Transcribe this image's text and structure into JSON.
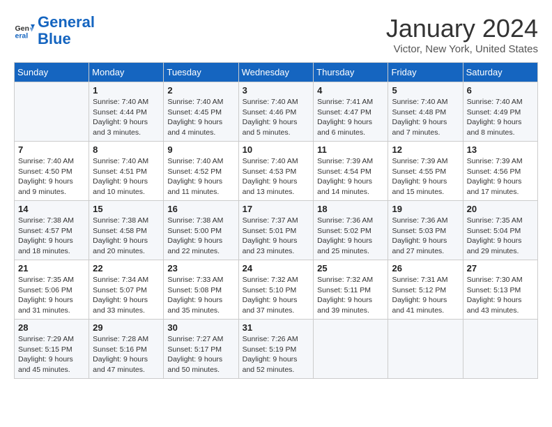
{
  "logo": {
    "text_general": "General",
    "text_blue": "Blue"
  },
  "title": "January 2024",
  "location": "Victor, New York, United States",
  "headers": [
    "Sunday",
    "Monday",
    "Tuesday",
    "Wednesday",
    "Thursday",
    "Friday",
    "Saturday"
  ],
  "weeks": [
    [
      {
        "day": "",
        "sunrise": "",
        "sunset": "",
        "daylight": ""
      },
      {
        "day": "1",
        "sunrise": "Sunrise: 7:40 AM",
        "sunset": "Sunset: 4:44 PM",
        "daylight": "Daylight: 9 hours and 3 minutes."
      },
      {
        "day": "2",
        "sunrise": "Sunrise: 7:40 AM",
        "sunset": "Sunset: 4:45 PM",
        "daylight": "Daylight: 9 hours and 4 minutes."
      },
      {
        "day": "3",
        "sunrise": "Sunrise: 7:40 AM",
        "sunset": "Sunset: 4:46 PM",
        "daylight": "Daylight: 9 hours and 5 minutes."
      },
      {
        "day": "4",
        "sunrise": "Sunrise: 7:41 AM",
        "sunset": "Sunset: 4:47 PM",
        "daylight": "Daylight: 9 hours and 6 minutes."
      },
      {
        "day": "5",
        "sunrise": "Sunrise: 7:40 AM",
        "sunset": "Sunset: 4:48 PM",
        "daylight": "Daylight: 9 hours and 7 minutes."
      },
      {
        "day": "6",
        "sunrise": "Sunrise: 7:40 AM",
        "sunset": "Sunset: 4:49 PM",
        "daylight": "Daylight: 9 hours and 8 minutes."
      }
    ],
    [
      {
        "day": "7",
        "sunrise": "Sunrise: 7:40 AM",
        "sunset": "Sunset: 4:50 PM",
        "daylight": "Daylight: 9 hours and 9 minutes."
      },
      {
        "day": "8",
        "sunrise": "Sunrise: 7:40 AM",
        "sunset": "Sunset: 4:51 PM",
        "daylight": "Daylight: 9 hours and 10 minutes."
      },
      {
        "day": "9",
        "sunrise": "Sunrise: 7:40 AM",
        "sunset": "Sunset: 4:52 PM",
        "daylight": "Daylight: 9 hours and 11 minutes."
      },
      {
        "day": "10",
        "sunrise": "Sunrise: 7:40 AM",
        "sunset": "Sunset: 4:53 PM",
        "daylight": "Daylight: 9 hours and 13 minutes."
      },
      {
        "day": "11",
        "sunrise": "Sunrise: 7:39 AM",
        "sunset": "Sunset: 4:54 PM",
        "daylight": "Daylight: 9 hours and 14 minutes."
      },
      {
        "day": "12",
        "sunrise": "Sunrise: 7:39 AM",
        "sunset": "Sunset: 4:55 PM",
        "daylight": "Daylight: 9 hours and 15 minutes."
      },
      {
        "day": "13",
        "sunrise": "Sunrise: 7:39 AM",
        "sunset": "Sunset: 4:56 PM",
        "daylight": "Daylight: 9 hours and 17 minutes."
      }
    ],
    [
      {
        "day": "14",
        "sunrise": "Sunrise: 7:38 AM",
        "sunset": "Sunset: 4:57 PM",
        "daylight": "Daylight: 9 hours and 18 minutes."
      },
      {
        "day": "15",
        "sunrise": "Sunrise: 7:38 AM",
        "sunset": "Sunset: 4:58 PM",
        "daylight": "Daylight: 9 hours and 20 minutes."
      },
      {
        "day": "16",
        "sunrise": "Sunrise: 7:38 AM",
        "sunset": "Sunset: 5:00 PM",
        "daylight": "Daylight: 9 hours and 22 minutes."
      },
      {
        "day": "17",
        "sunrise": "Sunrise: 7:37 AM",
        "sunset": "Sunset: 5:01 PM",
        "daylight": "Daylight: 9 hours and 23 minutes."
      },
      {
        "day": "18",
        "sunrise": "Sunrise: 7:36 AM",
        "sunset": "Sunset: 5:02 PM",
        "daylight": "Daylight: 9 hours and 25 minutes."
      },
      {
        "day": "19",
        "sunrise": "Sunrise: 7:36 AM",
        "sunset": "Sunset: 5:03 PM",
        "daylight": "Daylight: 9 hours and 27 minutes."
      },
      {
        "day": "20",
        "sunrise": "Sunrise: 7:35 AM",
        "sunset": "Sunset: 5:04 PM",
        "daylight": "Daylight: 9 hours and 29 minutes."
      }
    ],
    [
      {
        "day": "21",
        "sunrise": "Sunrise: 7:35 AM",
        "sunset": "Sunset: 5:06 PM",
        "daylight": "Daylight: 9 hours and 31 minutes."
      },
      {
        "day": "22",
        "sunrise": "Sunrise: 7:34 AM",
        "sunset": "Sunset: 5:07 PM",
        "daylight": "Daylight: 9 hours and 33 minutes."
      },
      {
        "day": "23",
        "sunrise": "Sunrise: 7:33 AM",
        "sunset": "Sunset: 5:08 PM",
        "daylight": "Daylight: 9 hours and 35 minutes."
      },
      {
        "day": "24",
        "sunrise": "Sunrise: 7:32 AM",
        "sunset": "Sunset: 5:10 PM",
        "daylight": "Daylight: 9 hours and 37 minutes."
      },
      {
        "day": "25",
        "sunrise": "Sunrise: 7:32 AM",
        "sunset": "Sunset: 5:11 PM",
        "daylight": "Daylight: 9 hours and 39 minutes."
      },
      {
        "day": "26",
        "sunrise": "Sunrise: 7:31 AM",
        "sunset": "Sunset: 5:12 PM",
        "daylight": "Daylight: 9 hours and 41 minutes."
      },
      {
        "day": "27",
        "sunrise": "Sunrise: 7:30 AM",
        "sunset": "Sunset: 5:13 PM",
        "daylight": "Daylight: 9 hours and 43 minutes."
      }
    ],
    [
      {
        "day": "28",
        "sunrise": "Sunrise: 7:29 AM",
        "sunset": "Sunset: 5:15 PM",
        "daylight": "Daylight: 9 hours and 45 minutes."
      },
      {
        "day": "29",
        "sunrise": "Sunrise: 7:28 AM",
        "sunset": "Sunset: 5:16 PM",
        "daylight": "Daylight: 9 hours and 47 minutes."
      },
      {
        "day": "30",
        "sunrise": "Sunrise: 7:27 AM",
        "sunset": "Sunset: 5:17 PM",
        "daylight": "Daylight: 9 hours and 50 minutes."
      },
      {
        "day": "31",
        "sunrise": "Sunrise: 7:26 AM",
        "sunset": "Sunset: 5:19 PM",
        "daylight": "Daylight: 9 hours and 52 minutes."
      },
      {
        "day": "",
        "sunrise": "",
        "sunset": "",
        "daylight": ""
      },
      {
        "day": "",
        "sunrise": "",
        "sunset": "",
        "daylight": ""
      },
      {
        "day": "",
        "sunrise": "",
        "sunset": "",
        "daylight": ""
      }
    ]
  ]
}
